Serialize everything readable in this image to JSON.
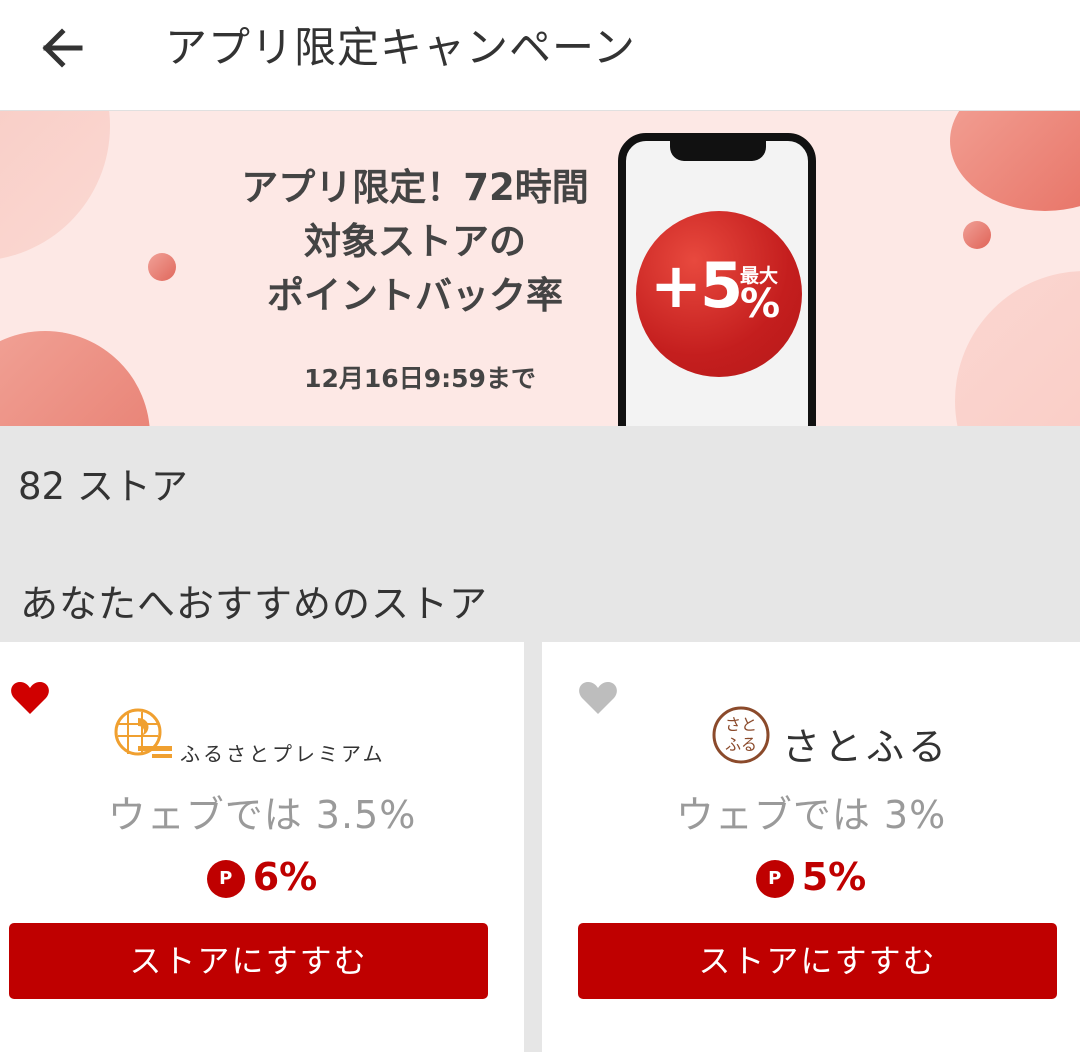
{
  "header": {
    "title": "アプリ限定キャンペーン",
    "back_icon": "arrow-left-icon"
  },
  "banner": {
    "line1": "アプリ限定！72時間",
    "line2": "対象ストアの",
    "line3": "ポイントバック率",
    "date": "12月16日9:59まで",
    "bonus": "+5",
    "bonus_max": "最大",
    "bonus_unit": "%",
    "accent_color": "#c41e1e"
  },
  "list": {
    "store_count": "82 ストア",
    "section_title": "あなたへおすすめのストア"
  },
  "stores": [
    {
      "logo_text": "ふるさとプレミアム",
      "favorited": true,
      "web_rate": "ウェブでは 3.5%",
      "point_badge": "P",
      "point_rate": "6%",
      "button_label": "ストアにすすむ"
    },
    {
      "logo_text": "さとふる",
      "logo_seal_text": "さとふる",
      "favorited": false,
      "web_rate": "ウェブでは 3%",
      "point_badge": "P",
      "point_rate": "5%",
      "button_label": "ストアにすすむ"
    }
  ],
  "colors": {
    "brand_red": "#bf0000",
    "heart_active": "#d00000",
    "heart_inactive": "#bdbdbd"
  }
}
